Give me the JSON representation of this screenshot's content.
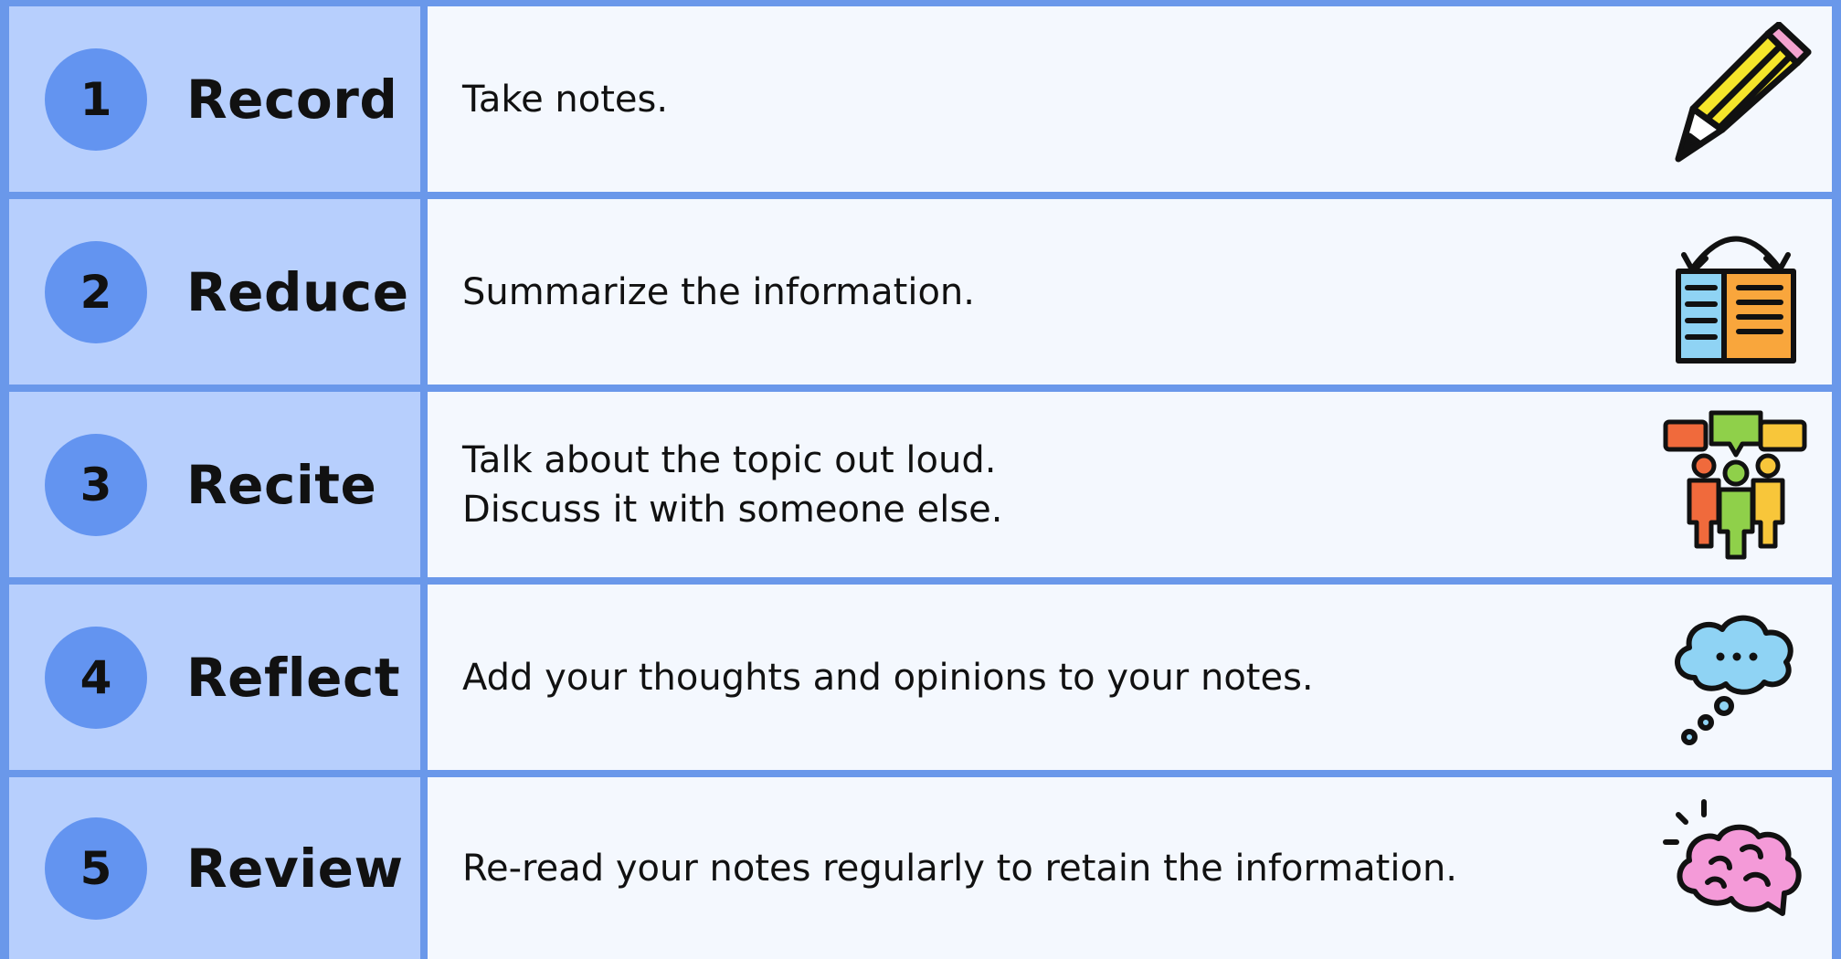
{
  "steps": [
    {
      "number": "1",
      "label": "Record",
      "lines": [
        "Take notes."
      ],
      "icon": "pencil-icon"
    },
    {
      "number": "2",
      "label": "Reduce",
      "lines": [
        "Summarize the information."
      ],
      "icon": "book-flip-icon"
    },
    {
      "number": "3",
      "label": "Recite",
      "lines": [
        "Talk about the topic out loud.",
        "Discuss it with someone else."
      ],
      "icon": "group-discussion-icon"
    },
    {
      "number": "4",
      "label": "Reflect",
      "lines": [
        "Add your thoughts and opinions to your notes."
      ],
      "icon": "thought-bubble-icon"
    },
    {
      "number": "5",
      "label": "Review",
      "lines": [
        "Re-read your notes regularly to retain the information."
      ],
      "icon": "brain-icon"
    }
  ],
  "colors": {
    "border": "#6a98ea",
    "step_cell": "#b7cffd",
    "number_circle": "#6394f0",
    "desc_cell": "#f4f8fe"
  }
}
